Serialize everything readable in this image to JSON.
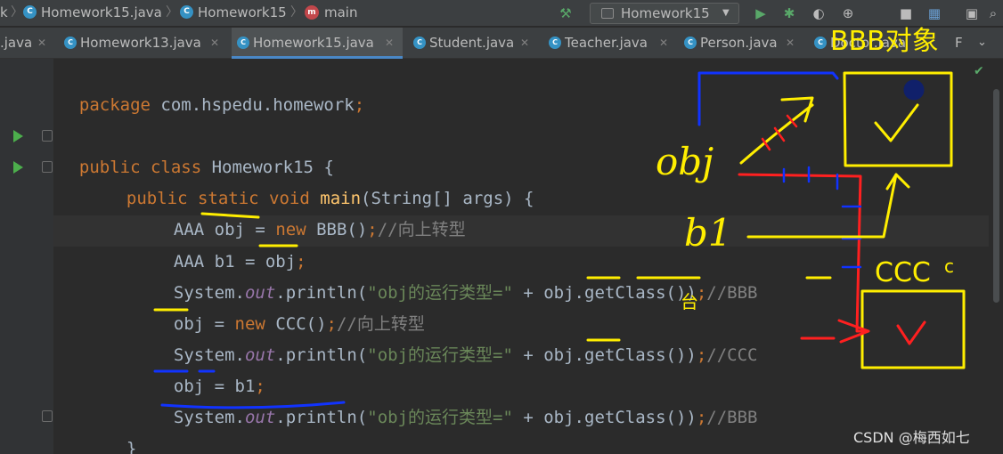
{
  "breadcrumbs": {
    "leading": "k",
    "file": "Homework15.java",
    "class": "Homework15",
    "method": "main"
  },
  "toolbar": {
    "run_config": "Homework15"
  },
  "tabs": [
    {
      "label": ".java",
      "active": false
    },
    {
      "label": "Homework13.java",
      "active": false
    },
    {
      "label": "Homework15.java",
      "active": true
    },
    {
      "label": "Student.java",
      "active": false
    },
    {
      "label": "Teacher.java",
      "active": false
    },
    {
      "label": "Person.java",
      "active": false
    },
    {
      "label": "Doctor.java",
      "active": false
    },
    {
      "label": "F",
      "active": false
    }
  ],
  "code": {
    "l1": {
      "kw": "package",
      "rest": " com.hspedu.homework",
      "semi": ";"
    },
    "l2": {
      "kw": "public class",
      "name": " Homework15 {"
    },
    "l3": {
      "kw": "public static void",
      "fn": "main",
      "rest": "(String[] args) {"
    },
    "l4": {
      "pre": "AAA ",
      "var": "obj",
      "mid": " = ",
      "kw": "new",
      "rest": " BBB()",
      "semi": ";",
      "cmt": "//向上转型"
    },
    "l5": {
      "pre": "AAA b1 = ",
      "var": "obj",
      "semi": ";"
    },
    "l6": {
      "sys": "System.",
      "out": "out",
      "call": ".println(",
      "str": "\"obj的运行类型=\"",
      "plus": " + ",
      "var": "obj",
      "dot": ".",
      "get": "getClass()",
      "close": ")",
      "semi": ";",
      "cmt": "//BBB"
    },
    "l7": {
      "var": "obj",
      "mid": " = ",
      "kw": "new",
      "rest": " CCC()",
      "semi": ";",
      "cmt": "//向上转型"
    },
    "l8": {
      "sys": "System.",
      "out": "out",
      "call": ".println(",
      "str": "\"obj的运行类型=\"",
      "plus": " + ",
      "var": "obj",
      "dot": ".",
      "get": "getClass()",
      "close": ")",
      "semi": ";",
      "cmt": "//CCC"
    },
    "l9": {
      "var": "obj",
      "mid": " = b1",
      "semi": ";"
    },
    "l10": {
      "sys": "System.",
      "out": "out",
      "call": ".println(",
      "str": "\"obj的运行类型=\"",
      "plus": " + ",
      "var": "obj",
      "dot": ".",
      "get": "getClass()",
      "close": ")",
      "semi": ";",
      "cmt": "//BBB"
    },
    "l11": {
      "brace": "}"
    }
  },
  "annotations": {
    "bbb_label": "BBB对象",
    "obj_label": "obj",
    "b1_label": "b1",
    "ccc_label": "CCC",
    "ccc_extra": "c",
    "under_label": "台"
  },
  "watermark": "CSDN @梅西如七",
  "colors": {
    "keyword": "#cc7832",
    "string": "#6a8759",
    "method": "#ffc66d",
    "comment": "#808080",
    "field": "#9876aa",
    "ink_yellow": "#ffee00",
    "ink_blue": "#1133ff",
    "ink_red": "#ff2020"
  }
}
